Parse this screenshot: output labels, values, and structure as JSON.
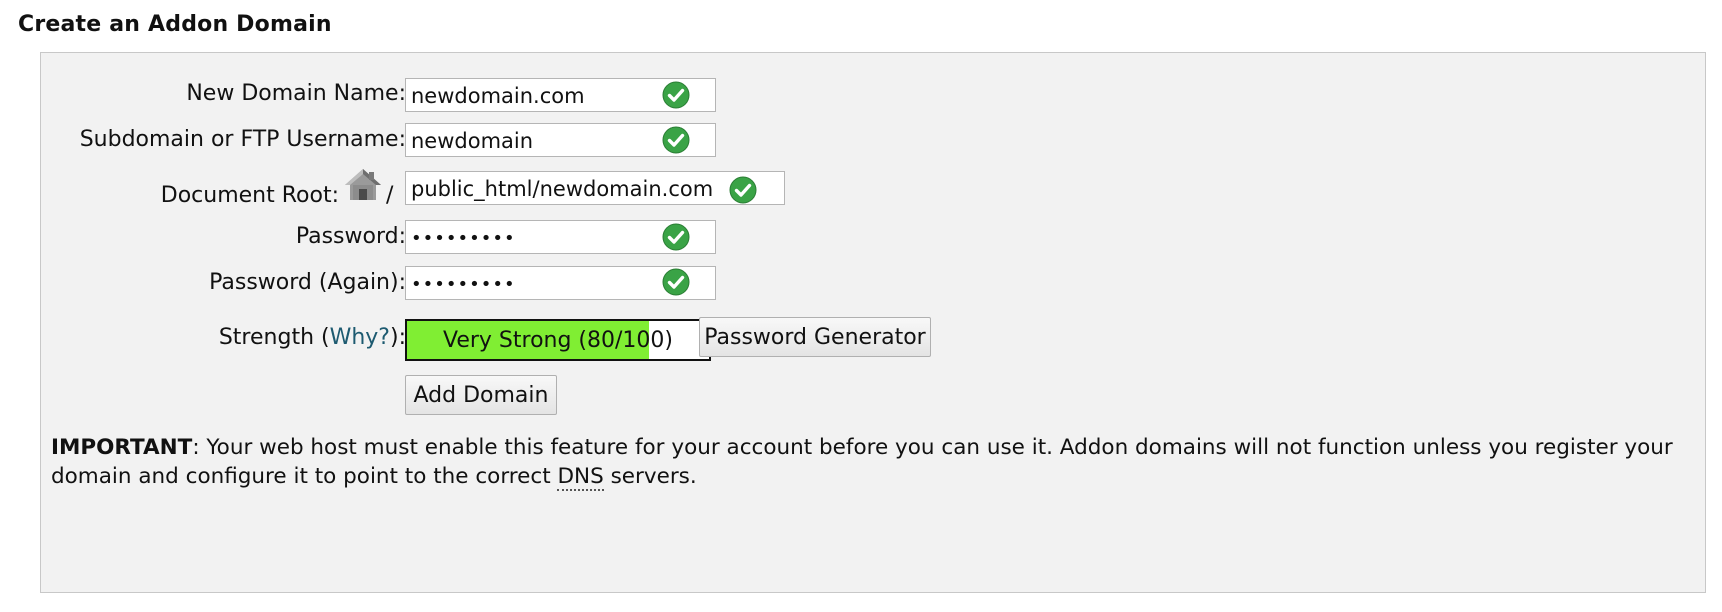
{
  "page": {
    "title": "Create an Addon Domain"
  },
  "form": {
    "new_domain": {
      "label": "New Domain Name:",
      "value": "newdomain.com",
      "status_icon": "valid-check-icon"
    },
    "subdomain": {
      "label": "Subdomain or FTP Username:",
      "value": "newdomain",
      "status_icon": "valid-check-icon"
    },
    "document_root": {
      "label": "Document Root:",
      "home_icon": "home-icon",
      "separator": "/",
      "value": "public_html/newdomain.com",
      "status_icon": "valid-check-icon"
    },
    "password": {
      "label": "Password:",
      "value": "•••••••••",
      "status_icon": "valid-check-icon"
    },
    "password_again": {
      "label": "Password (Again):",
      "value": "•••••••••",
      "status_icon": "valid-check-icon"
    },
    "strength": {
      "label_prefix": "Strength (",
      "why_link": "Why?",
      "label_suffix": "):",
      "text": "Very Strong (80/100)",
      "score": 80,
      "max": 100,
      "bar_color": "#80ee33"
    },
    "password_generator_label": "Password Generator",
    "add_domain_label": "Add Domain"
  },
  "notice": {
    "important_label": "IMPORTANT",
    "text_before_dns": ": Your web host must enable this feature for your account before you can use it. Addon domains will not function unless you register your domain and configure it to point to the correct ",
    "dns_abbr": "DNS",
    "text_after_dns": " servers."
  },
  "colors": {
    "check_green": "#3aa346",
    "link": "#1d5a70",
    "panel_bg": "#f2f2f2"
  }
}
